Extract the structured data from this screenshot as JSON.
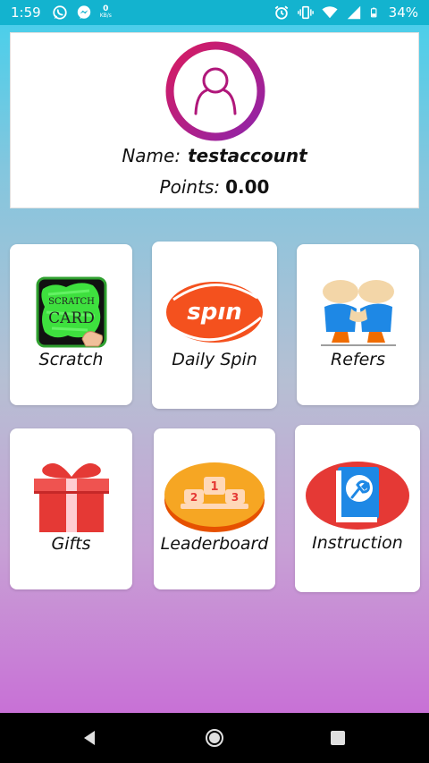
{
  "status_bar": {
    "time": "1:59",
    "net_speed_value": "0",
    "net_speed_unit": "KB/s",
    "battery": "34%"
  },
  "profile": {
    "name_label": "Name:",
    "name_value": "testaccount",
    "points_label": "Points:",
    "points_value": "0.00",
    "avatar_ring_colors": [
      "#d81b60",
      "#8e24aa"
    ]
  },
  "menu": {
    "scratch": {
      "label": "Scratch",
      "card_line1": "SCRATCH",
      "card_line2": "CARD"
    },
    "daily_spin": {
      "label": "Daily Spin",
      "logo_text": "spın"
    },
    "refers": {
      "label": "Refers"
    },
    "gifts": {
      "label": "Gifts"
    },
    "leaderboard": {
      "label": "Leaderboard",
      "podium": [
        "1",
        "2",
        "3"
      ]
    },
    "instruction": {
      "label": "Instruction"
    }
  },
  "icons": [
    "whatsapp-icon",
    "messenger-icon",
    "alarm-icon",
    "vibrate-icon",
    "wifi-icon",
    "signal-icon",
    "battery-icon",
    "back-icon",
    "home-icon",
    "recents-icon"
  ]
}
